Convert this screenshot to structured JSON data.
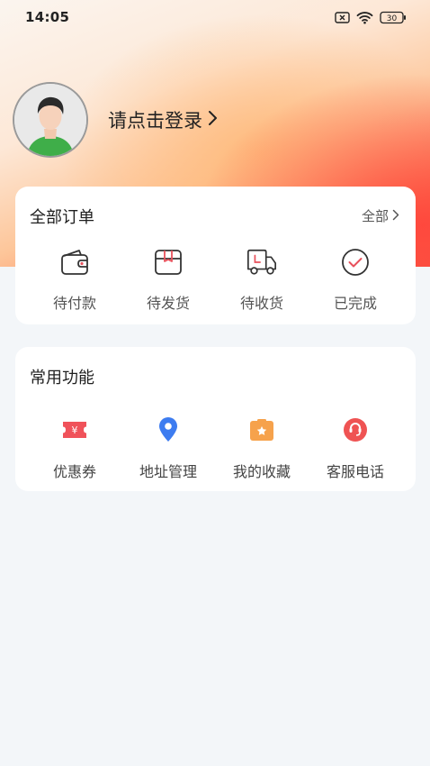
{
  "status_bar": {
    "time": "14:05",
    "battery": "30"
  },
  "profile": {
    "login_text": "请点击登录"
  },
  "orders": {
    "title": "全部订单",
    "all_label": "全部",
    "items": [
      {
        "label": "待付款",
        "icon": "wallet-icon"
      },
      {
        "label": "待发货",
        "icon": "package-icon"
      },
      {
        "label": "待收货",
        "icon": "truck-icon"
      },
      {
        "label": "已完成",
        "icon": "check-circle-icon"
      }
    ]
  },
  "functions": {
    "title": "常用功能",
    "items": [
      {
        "label": "优惠券",
        "icon": "coupon-icon",
        "color": "#f0525a"
      },
      {
        "label": "地址管理",
        "icon": "location-pin-icon",
        "color": "#3d7cf0"
      },
      {
        "label": "我的收藏",
        "icon": "favorites-icon",
        "color": "#f6a24c"
      },
      {
        "label": "客服电话",
        "icon": "customer-service-icon",
        "color": "#ef5353"
      }
    ]
  },
  "colors": {
    "accent": "#f55b45",
    "icon_stroke": "#333333",
    "check_accent": "#e8505b",
    "background": "#f3f6f9"
  }
}
